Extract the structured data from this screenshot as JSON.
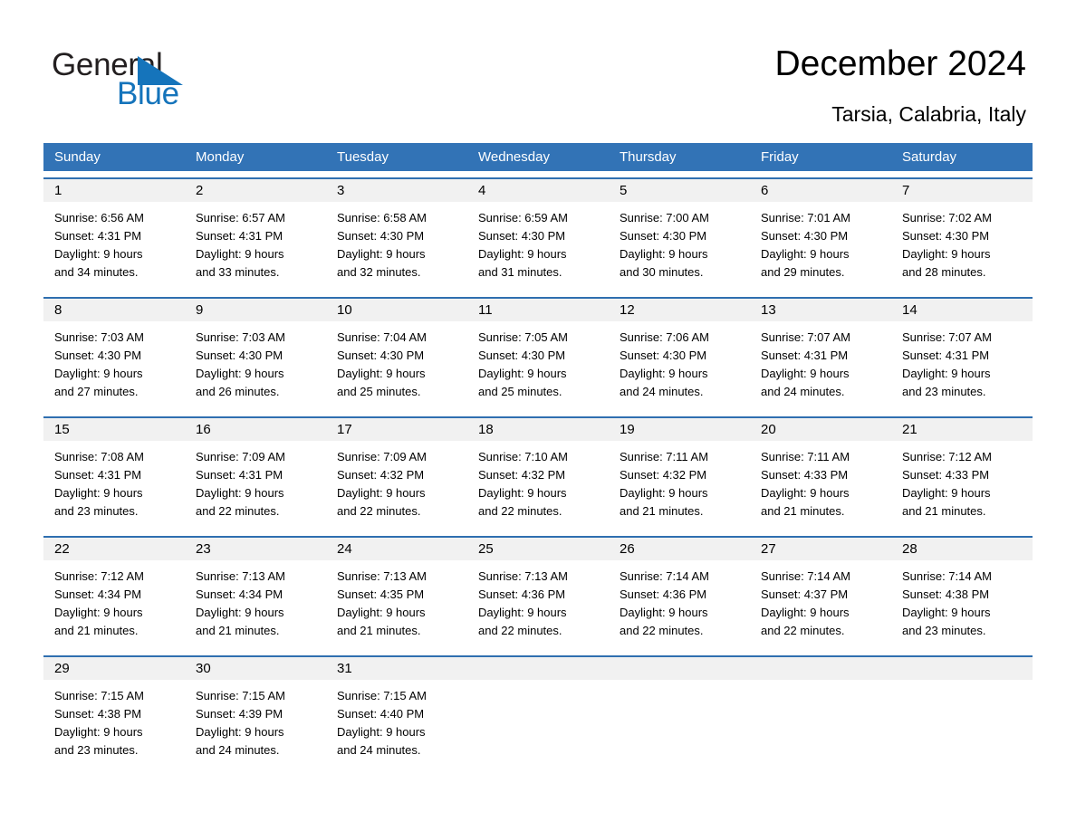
{
  "brand": {
    "name_part1": "General",
    "name_part2": "Blue",
    "accent_color": "#1574bb",
    "triangle_icon": "triangle-icon"
  },
  "header": {
    "title": "December 2024",
    "subtitle": "Tarsia, Calabria, Italy"
  },
  "theme": {
    "header_bar_color": "#3273b6",
    "week_divider_color": "#2f6fb0",
    "date_band_color": "#f1f1f1",
    "text_color": "#000000"
  },
  "weekday_headers": [
    "Sunday",
    "Monday",
    "Tuesday",
    "Wednesday",
    "Thursday",
    "Friday",
    "Saturday"
  ],
  "weeks": [
    {
      "days": [
        {
          "date": "1",
          "l1": "Sunrise: 6:56 AM",
          "l2": "Sunset: 4:31 PM",
          "l3": "Daylight: 9 hours",
          "l4": "and 34 minutes."
        },
        {
          "date": "2",
          "l1": "Sunrise: 6:57 AM",
          "l2": "Sunset: 4:31 PM",
          "l3": "Daylight: 9 hours",
          "l4": "and 33 minutes."
        },
        {
          "date": "3",
          "l1": "Sunrise: 6:58 AM",
          "l2": "Sunset: 4:30 PM",
          "l3": "Daylight: 9 hours",
          "l4": "and 32 minutes."
        },
        {
          "date": "4",
          "l1": "Sunrise: 6:59 AM",
          "l2": "Sunset: 4:30 PM",
          "l3": "Daylight: 9 hours",
          "l4": "and 31 minutes."
        },
        {
          "date": "5",
          "l1": "Sunrise: 7:00 AM",
          "l2": "Sunset: 4:30 PM",
          "l3": "Daylight: 9 hours",
          "l4": "and 30 minutes."
        },
        {
          "date": "6",
          "l1": "Sunrise: 7:01 AM",
          "l2": "Sunset: 4:30 PM",
          "l3": "Daylight: 9 hours",
          "l4": "and 29 minutes."
        },
        {
          "date": "7",
          "l1": "Sunrise: 7:02 AM",
          "l2": "Sunset: 4:30 PM",
          "l3": "Daylight: 9 hours",
          "l4": "and 28 minutes."
        }
      ]
    },
    {
      "days": [
        {
          "date": "8",
          "l1": "Sunrise: 7:03 AM",
          "l2": "Sunset: 4:30 PM",
          "l3": "Daylight: 9 hours",
          "l4": "and 27 minutes."
        },
        {
          "date": "9",
          "l1": "Sunrise: 7:03 AM",
          "l2": "Sunset: 4:30 PM",
          "l3": "Daylight: 9 hours",
          "l4": "and 26 minutes."
        },
        {
          "date": "10",
          "l1": "Sunrise: 7:04 AM",
          "l2": "Sunset: 4:30 PM",
          "l3": "Daylight: 9 hours",
          "l4": "and 25 minutes."
        },
        {
          "date": "11",
          "l1": "Sunrise: 7:05 AM",
          "l2": "Sunset: 4:30 PM",
          "l3": "Daylight: 9 hours",
          "l4": "and 25 minutes."
        },
        {
          "date": "12",
          "l1": "Sunrise: 7:06 AM",
          "l2": "Sunset: 4:30 PM",
          "l3": "Daylight: 9 hours",
          "l4": "and 24 minutes."
        },
        {
          "date": "13",
          "l1": "Sunrise: 7:07 AM",
          "l2": "Sunset: 4:31 PM",
          "l3": "Daylight: 9 hours",
          "l4": "and 24 minutes."
        },
        {
          "date": "14",
          "l1": "Sunrise: 7:07 AM",
          "l2": "Sunset: 4:31 PM",
          "l3": "Daylight: 9 hours",
          "l4": "and 23 minutes."
        }
      ]
    },
    {
      "days": [
        {
          "date": "15",
          "l1": "Sunrise: 7:08 AM",
          "l2": "Sunset: 4:31 PM",
          "l3": "Daylight: 9 hours",
          "l4": "and 23 minutes."
        },
        {
          "date": "16",
          "l1": "Sunrise: 7:09 AM",
          "l2": "Sunset: 4:31 PM",
          "l3": "Daylight: 9 hours",
          "l4": "and 22 minutes."
        },
        {
          "date": "17",
          "l1": "Sunrise: 7:09 AM",
          "l2": "Sunset: 4:32 PM",
          "l3": "Daylight: 9 hours",
          "l4": "and 22 minutes."
        },
        {
          "date": "18",
          "l1": "Sunrise: 7:10 AM",
          "l2": "Sunset: 4:32 PM",
          "l3": "Daylight: 9 hours",
          "l4": "and 22 minutes."
        },
        {
          "date": "19",
          "l1": "Sunrise: 7:11 AM",
          "l2": "Sunset: 4:32 PM",
          "l3": "Daylight: 9 hours",
          "l4": "and 21 minutes."
        },
        {
          "date": "20",
          "l1": "Sunrise: 7:11 AM",
          "l2": "Sunset: 4:33 PM",
          "l3": "Daylight: 9 hours",
          "l4": "and 21 minutes."
        },
        {
          "date": "21",
          "l1": "Sunrise: 7:12 AM",
          "l2": "Sunset: 4:33 PM",
          "l3": "Daylight: 9 hours",
          "l4": "and 21 minutes."
        }
      ]
    },
    {
      "days": [
        {
          "date": "22",
          "l1": "Sunrise: 7:12 AM",
          "l2": "Sunset: 4:34 PM",
          "l3": "Daylight: 9 hours",
          "l4": "and 21 minutes."
        },
        {
          "date": "23",
          "l1": "Sunrise: 7:13 AM",
          "l2": "Sunset: 4:34 PM",
          "l3": "Daylight: 9 hours",
          "l4": "and 21 minutes."
        },
        {
          "date": "24",
          "l1": "Sunrise: 7:13 AM",
          "l2": "Sunset: 4:35 PM",
          "l3": "Daylight: 9 hours",
          "l4": "and 21 minutes."
        },
        {
          "date": "25",
          "l1": "Sunrise: 7:13 AM",
          "l2": "Sunset: 4:36 PM",
          "l3": "Daylight: 9 hours",
          "l4": "and 22 minutes."
        },
        {
          "date": "26",
          "l1": "Sunrise: 7:14 AM",
          "l2": "Sunset: 4:36 PM",
          "l3": "Daylight: 9 hours",
          "l4": "and 22 minutes."
        },
        {
          "date": "27",
          "l1": "Sunrise: 7:14 AM",
          "l2": "Sunset: 4:37 PM",
          "l3": "Daylight: 9 hours",
          "l4": "and 22 minutes."
        },
        {
          "date": "28",
          "l1": "Sunrise: 7:14 AM",
          "l2": "Sunset: 4:38 PM",
          "l3": "Daylight: 9 hours",
          "l4": "and 23 minutes."
        }
      ]
    },
    {
      "days": [
        {
          "date": "29",
          "l1": "Sunrise: 7:15 AM",
          "l2": "Sunset: 4:38 PM",
          "l3": "Daylight: 9 hours",
          "l4": "and 23 minutes."
        },
        {
          "date": "30",
          "l1": "Sunrise: 7:15 AM",
          "l2": "Sunset: 4:39 PM",
          "l3": "Daylight: 9 hours",
          "l4": "and 24 minutes."
        },
        {
          "date": "31",
          "l1": "Sunrise: 7:15 AM",
          "l2": "Sunset: 4:40 PM",
          "l3": "Daylight: 9 hours",
          "l4": "and 24 minutes."
        },
        {
          "date": "",
          "l1": "",
          "l2": "",
          "l3": "",
          "l4": ""
        },
        {
          "date": "",
          "l1": "",
          "l2": "",
          "l3": "",
          "l4": ""
        },
        {
          "date": "",
          "l1": "",
          "l2": "",
          "l3": "",
          "l4": ""
        },
        {
          "date": "",
          "l1": "",
          "l2": "",
          "l3": "",
          "l4": ""
        }
      ]
    }
  ]
}
